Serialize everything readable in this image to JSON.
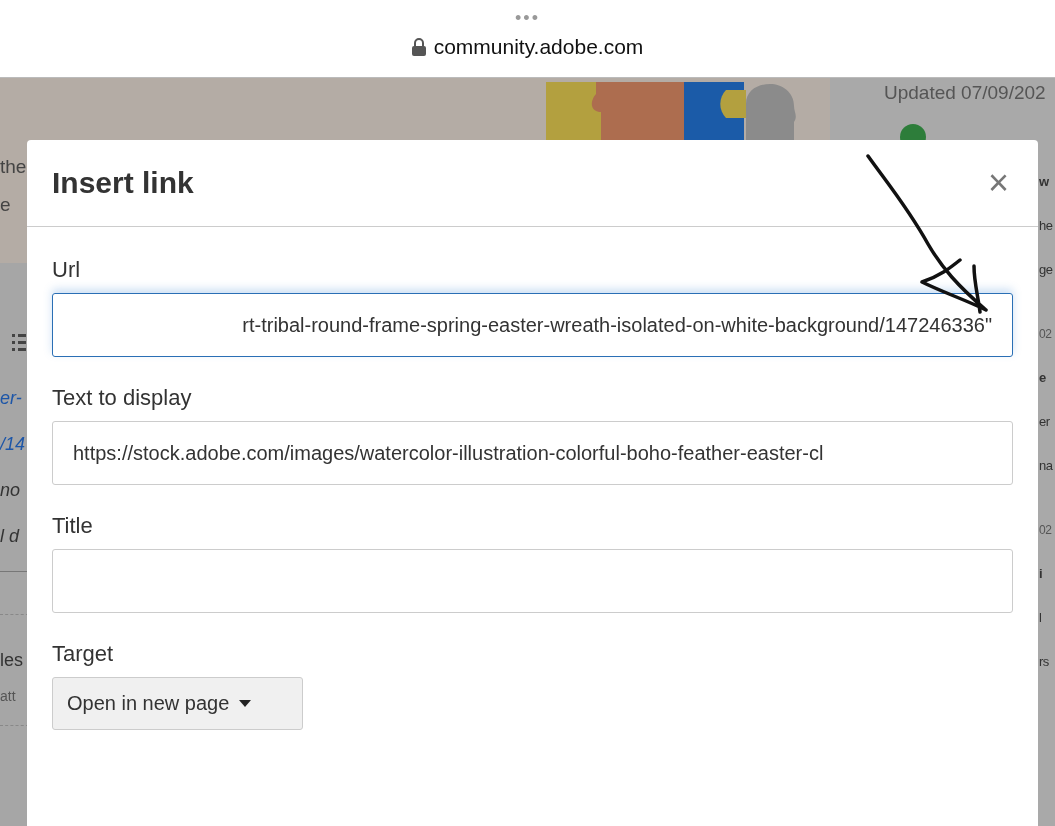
{
  "browser": {
    "menu": "•••",
    "url": "community.adobe.com"
  },
  "background": {
    "left_fragments": [
      "the",
      "e"
    ],
    "left_list": [
      {
        "text": "er-",
        "kind": "link"
      },
      {
        "text": "/14",
        "kind": "link"
      },
      {
        "text": "no",
        "kind": "italic"
      },
      {
        "text": "l d",
        "kind": "italic"
      }
    ],
    "left_lower": [
      {
        "text": "les",
        "kind": "title"
      },
      {
        "text": "att",
        "kind": "meta"
      }
    ],
    "updated": "Updated 07/09/202",
    "right_fragments": [
      {
        "text": "w",
        "kind": "title"
      },
      {
        "text": "he",
        "kind": "body"
      },
      {
        "text": "ge",
        "kind": "body"
      },
      {
        "text": "02",
        "kind": "date"
      },
      {
        "text": "e",
        "kind": "title"
      },
      {
        "text": "er",
        "kind": "body"
      },
      {
        "text": "na",
        "kind": "body"
      },
      {
        "text": "02",
        "kind": "date"
      },
      {
        "text": "i",
        "kind": "title"
      },
      {
        "text": "l",
        "kind": "body"
      },
      {
        "text": "rs",
        "kind": "body"
      }
    ]
  },
  "dialog": {
    "title": "Insert link",
    "close": "×",
    "fields": [
      {
        "label": "Url",
        "kind": "text",
        "value": "rt-tribal-round-frame-spring-easter-wreath-isolated-on-white-background/147246336\"",
        "focused": true
      },
      {
        "label": "Text to display",
        "kind": "text",
        "value": "https://stock.adobe.com/images/watercolor-illustration-colorful-boho-feather-easter-cl",
        "focused": false
      },
      {
        "label": "Title",
        "kind": "text",
        "focused": false
      },
      {
        "label": "Target",
        "kind": "select",
        "value": "Open in new page"
      }
    ]
  }
}
